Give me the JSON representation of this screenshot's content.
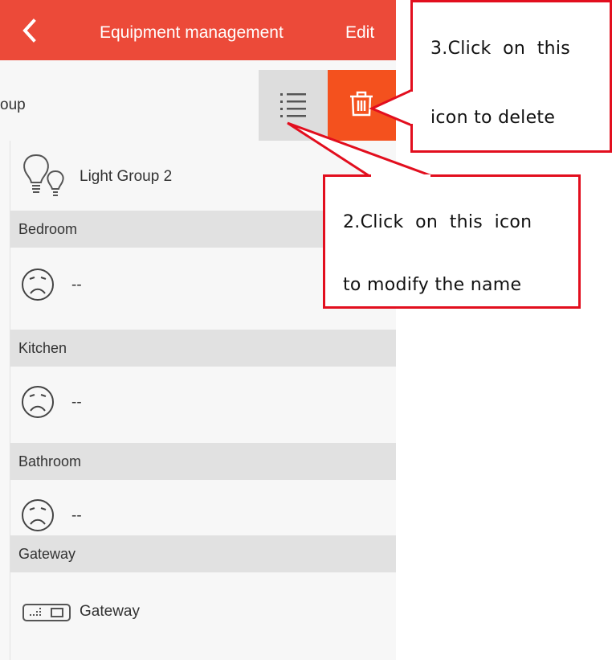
{
  "header": {
    "title": "Equipment management",
    "edit_label": "Edit"
  },
  "group_row": {
    "label": "oup"
  },
  "light_group": {
    "label": "Light Group 2"
  },
  "sections": [
    {
      "label": "Bedroom",
      "device": "--"
    },
    {
      "label": "Kitchen",
      "device": "--"
    },
    {
      "label": "Bathroom",
      "device": "--"
    },
    {
      "label": "Gateway",
      "device": "Gateway"
    }
  ],
  "callouts": {
    "delete": {
      "line1": "3.Click  on  this",
      "line2": "icon to delete"
    },
    "rename": {
      "line1": "2.Click  on  this  icon",
      "line2": "to modify the name"
    }
  },
  "colors": {
    "header_bg": "#ec4a39",
    "delete_bg": "#f4511e",
    "callout_border": "#e20e1e"
  },
  "icons": [
    "back-chevron-icon",
    "list-icon",
    "trash-icon",
    "bulb-group-icon",
    "sad-face-icon",
    "gateway-device-icon"
  ]
}
